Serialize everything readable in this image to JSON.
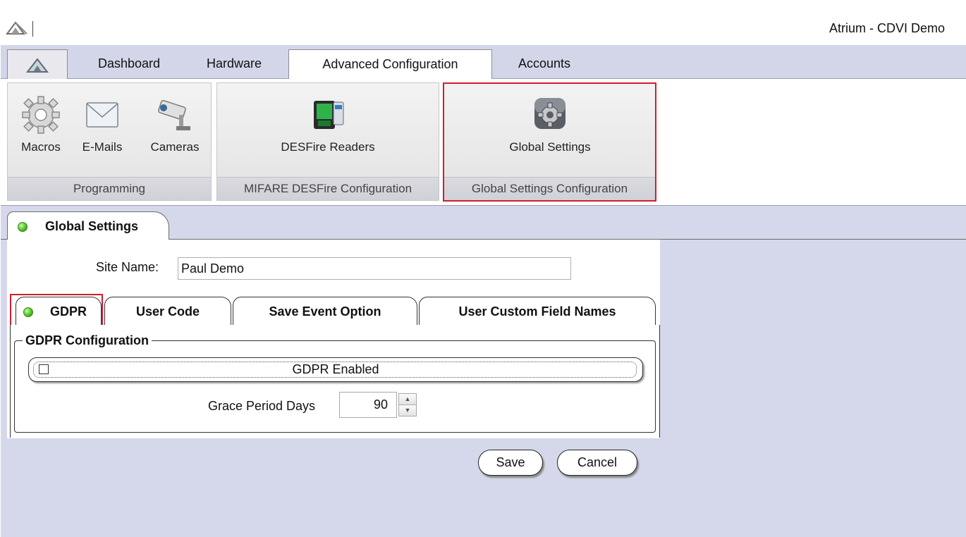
{
  "window": {
    "title": "Atrium - CDVI Demo",
    "logo_icon": "atrium-logo-icon"
  },
  "ribbon_tabs": [
    {
      "label": "Dashboard"
    },
    {
      "label": "Hardware"
    },
    {
      "label": "Advanced Configuration",
      "active": true
    },
    {
      "label": "Accounts"
    }
  ],
  "ribbon_groups": {
    "programming": {
      "label": "Programming",
      "buttons": [
        {
          "label": "Macros",
          "icon": "gear-icon"
        },
        {
          "label": "E-Mails",
          "icon": "envelope-icon"
        },
        {
          "label": "Cameras",
          "icon": "camera-icon"
        }
      ]
    },
    "desfire": {
      "label": "MIFARE DESFire Configuration",
      "button": {
        "label": "DESFire Readers",
        "icon": "card-reader-icon"
      }
    },
    "global": {
      "label": "Global Settings Configuration",
      "button": {
        "label": "Global Settings",
        "icon": "settings-gear-icon"
      }
    }
  },
  "document_tab": {
    "label": "Global Settings",
    "status_color": "#4ec22a"
  },
  "site": {
    "label": "Site Name:",
    "value": "Paul Demo"
  },
  "inner_tabs": [
    {
      "label": "GDPR",
      "active": true
    },
    {
      "label": "User Code"
    },
    {
      "label": "Save Event Option"
    },
    {
      "label": "User Custom Field Names"
    }
  ],
  "gdpr": {
    "legend": "GDPR Configuration",
    "enabled_label": "GDPR Enabled",
    "enabled": false,
    "grace_label": "Grace Period Days",
    "grace_value": "90"
  },
  "actions": {
    "save": "Save",
    "cancel": "Cancel"
  },
  "colors": {
    "tabstrip": "#d3d6e8",
    "doc_background": "#d5d8ea",
    "highlight": "#d01e2e",
    "led": "#4ec22a"
  }
}
